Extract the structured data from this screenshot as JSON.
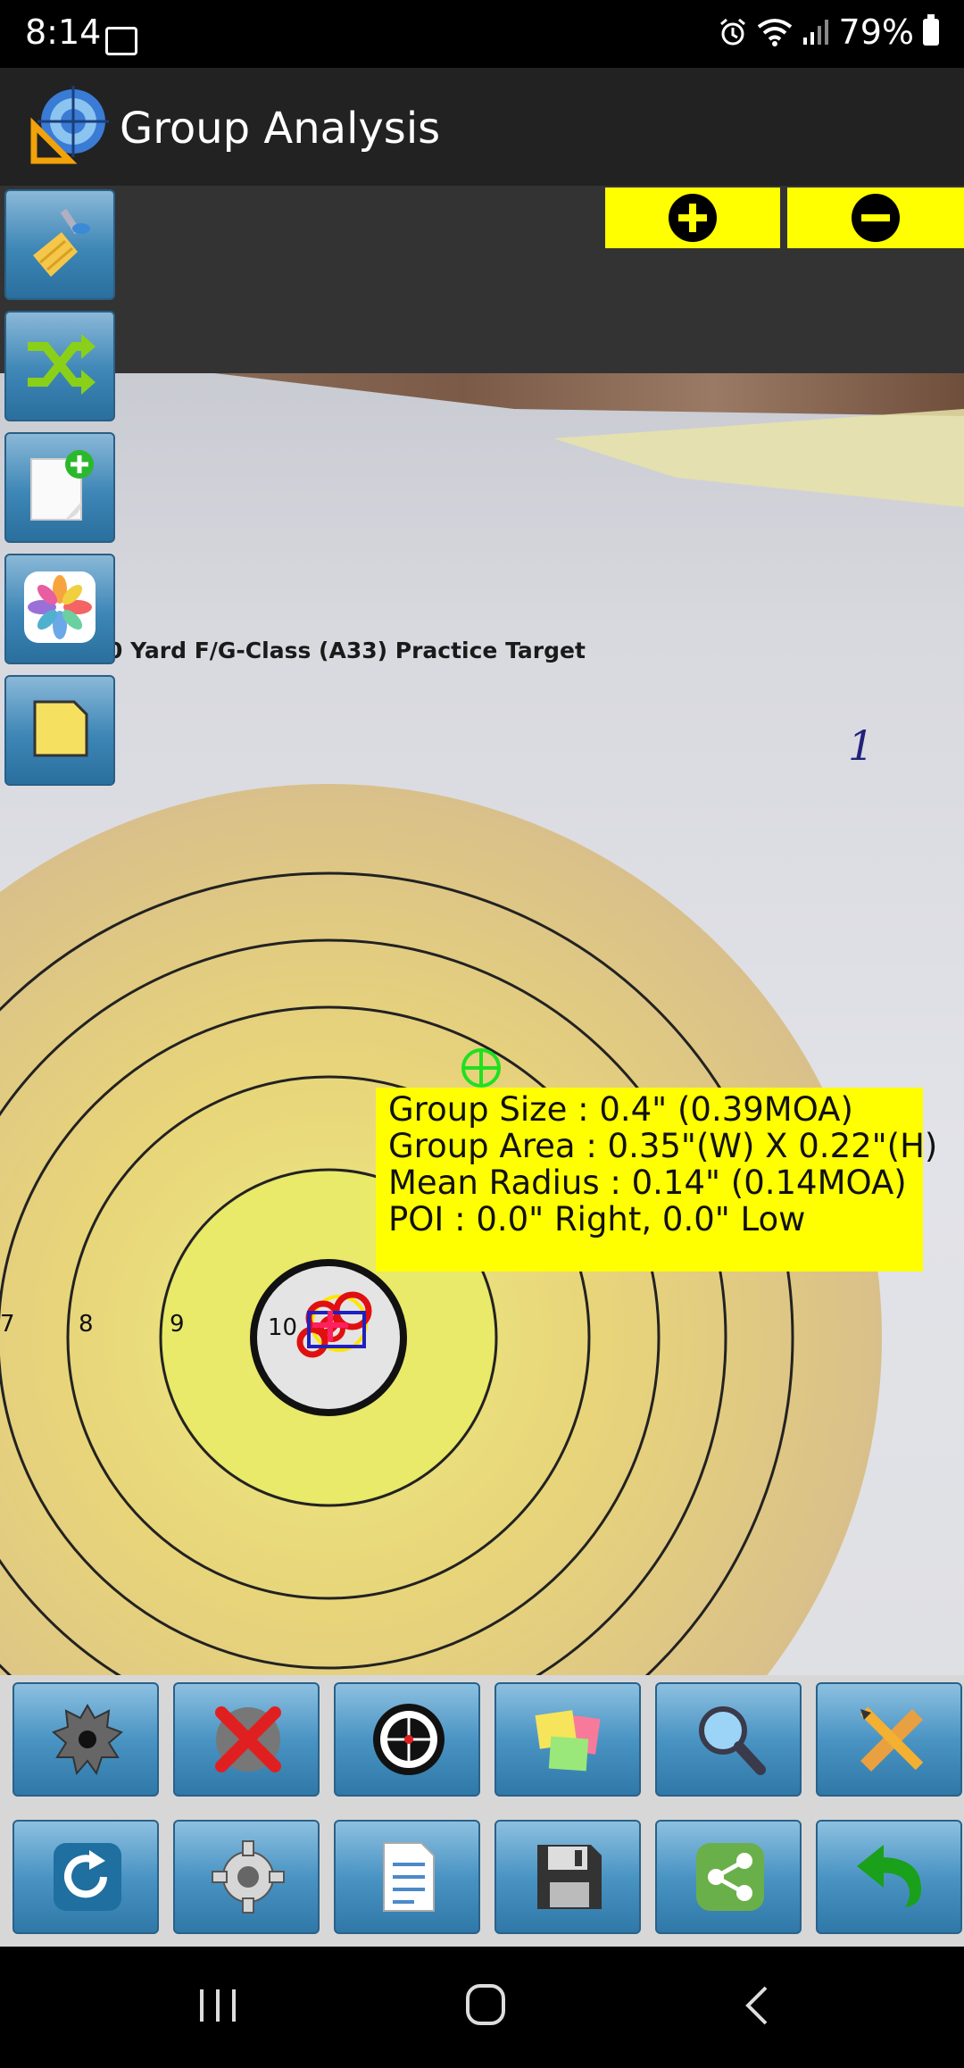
{
  "status_bar": {
    "time": "8:14",
    "battery_percent": "79%",
    "icons": [
      "gallery-icon",
      "alarm-icon",
      "wifi-icon",
      "signal-icon",
      "battery-icon"
    ]
  },
  "app_bar": {
    "title": "Group Analysis",
    "icon": "target-ruler-app-icon"
  },
  "zoom_controls": {
    "zoom_in_icon": "plus-circle-icon",
    "zoom_out_icon": "minus-circle-icon",
    "color": "#ffff00"
  },
  "left_toolbar": [
    {
      "name": "clear-button",
      "icon": "broom-icon"
    },
    {
      "name": "shuffle-button",
      "icon": "shuffle-icon"
    },
    {
      "name": "new-document-button",
      "icon": "add-document-icon"
    },
    {
      "name": "gallery-button",
      "icon": "photos-flower-icon"
    },
    {
      "name": "notes-button",
      "icon": "note-icon"
    }
  ],
  "target": {
    "title": "0 Yard F/G-Class (A33) Practice Target",
    "handwritten_label": "1",
    "ring_numbers": [
      "7",
      "8",
      "9",
      "10"
    ]
  },
  "analysis": {
    "group_size": "Group Size : 0.4\" (0.39MOA)",
    "group_area": "Group Area : 0.35\"(W) X 0.22\"(H)",
    "mean_radius": "Mean Radius : 0.14\" (0.14MOA)",
    "poi": "POI : 0.0\" Right,  0.0\" Low",
    "box_color": "#ffff00"
  },
  "bottom_toolbar_row1": [
    {
      "name": "bullet-hole-button",
      "icon": "bullet-hole-icon"
    },
    {
      "name": "delete-hole-button",
      "icon": "delete-x-icon"
    },
    {
      "name": "target-center-button",
      "icon": "target-crosshair-icon"
    },
    {
      "name": "sticky-notes-button",
      "icon": "sticky-notes-icon"
    },
    {
      "name": "zoom-search-button",
      "icon": "magnifier-icon"
    },
    {
      "name": "measure-button",
      "icon": "pencil-ruler-icon"
    }
  ],
  "bottom_toolbar_row2": [
    {
      "name": "refresh-button",
      "icon": "refresh-icon"
    },
    {
      "name": "settings-button",
      "icon": "gear-icon"
    },
    {
      "name": "report-button",
      "icon": "checklist-icon"
    },
    {
      "name": "save-button",
      "icon": "floppy-disk-icon"
    },
    {
      "name": "share-button",
      "icon": "share-icon"
    },
    {
      "name": "back-button",
      "icon": "undo-arrow-icon"
    }
  ],
  "nav_bar": {
    "icons": [
      "recents-icon",
      "home-icon",
      "back-nav-icon"
    ]
  }
}
